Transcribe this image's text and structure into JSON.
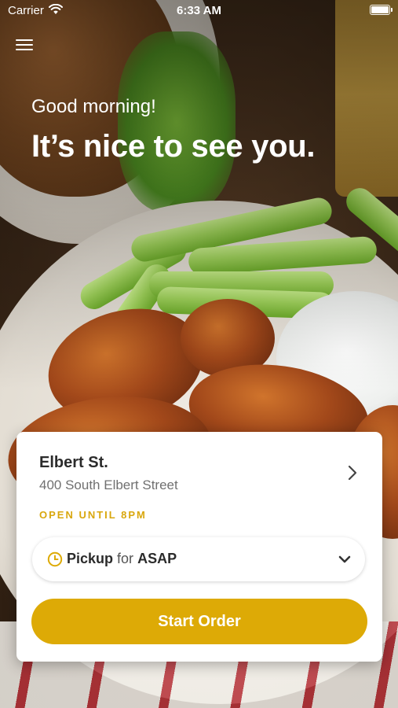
{
  "status_bar": {
    "carrier": "Carrier",
    "time": "6:33 AM",
    "wifi_icon": "wifi-icon",
    "battery_icon": "battery-icon"
  },
  "header": {
    "menu_icon": "hamburger-menu-icon",
    "greeting": "Good morning!",
    "headline": "It’s nice to see you."
  },
  "location": {
    "name": "Elbert St.",
    "address": "400 South Elbert Street",
    "hours": "OPEN UNTIL 8PM",
    "chevron_icon": "chevron-right-icon"
  },
  "order_mode": {
    "icon": "clock-icon",
    "mode": "Pickup",
    "connector": "for",
    "time": "ASAP",
    "dropdown_icon": "chevron-down-icon"
  },
  "actions": {
    "start_order": "Start Order"
  },
  "colors": {
    "accent": "#ddaa06",
    "hours_text": "#d9a70d",
    "card_bg": "#ffffff"
  }
}
